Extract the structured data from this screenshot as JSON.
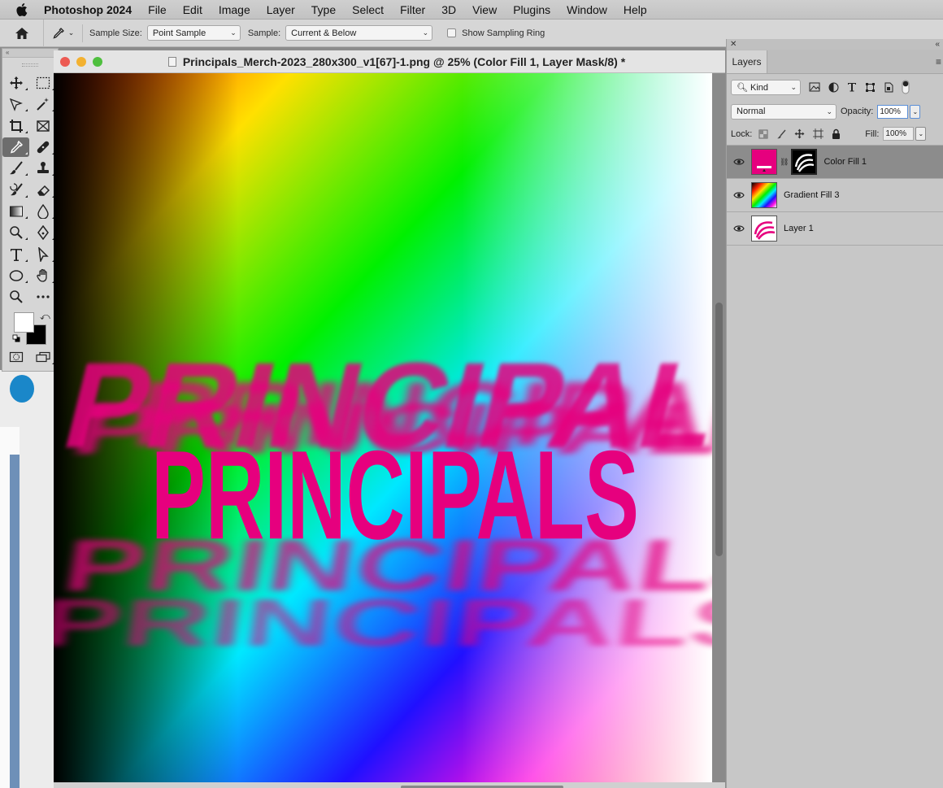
{
  "menubar": {
    "app": "Photoshop 2024",
    "items": [
      "File",
      "Edit",
      "Image",
      "Layer",
      "Type",
      "Select",
      "Filter",
      "3D",
      "View",
      "Plugins",
      "Window",
      "Help"
    ]
  },
  "options": {
    "sample_size_label": "Sample Size:",
    "sample_size_value": "Point Sample",
    "sample_label": "Sample:",
    "sample_value": "Current & Below",
    "sampling_ring_label": "Show Sampling Ring"
  },
  "document": {
    "title": "Principals_Merch-2023_280x300_v1[67]-1.png @ 25% (Color Fill 1, Layer Mask/8) *",
    "artwork_text": "PRINCIPALS"
  },
  "tools": {
    "icons": [
      "move-icon",
      "marquee-icon",
      "lasso-icon",
      "magic-wand-icon",
      "crop-icon",
      "frame-icon",
      "eyedropper-icon",
      "healing-brush-icon",
      "brush-icon",
      "clone-stamp-icon",
      "history-brush-icon",
      "eraser-icon",
      "gradient-icon",
      "blur-icon",
      "dodge-icon",
      "pen-icon",
      "type-icon",
      "path-selection-icon",
      "ellipse-icon",
      "hand-icon",
      "zoom-icon",
      "more-tools-icon"
    ],
    "active": "eyedropper-icon",
    "foreground_color": "#ffffff",
    "background_color": "#000000"
  },
  "layers_panel": {
    "tab": "Layers",
    "filter_kind": "Kind",
    "blend_mode": "Normal",
    "opacity_label": "Opacity:",
    "opacity_value": "100%",
    "lock_label": "Lock:",
    "fill_label": "Fill:",
    "fill_value": "100%",
    "layers": [
      {
        "name": "Color Fill 1",
        "selected": true
      },
      {
        "name": "Gradient Fill 3",
        "selected": false
      },
      {
        "name": "Layer 1",
        "selected": false
      }
    ]
  },
  "colors": {
    "accent_magenta": "#e6007e",
    "selection_blue": "#5b8fd8"
  }
}
